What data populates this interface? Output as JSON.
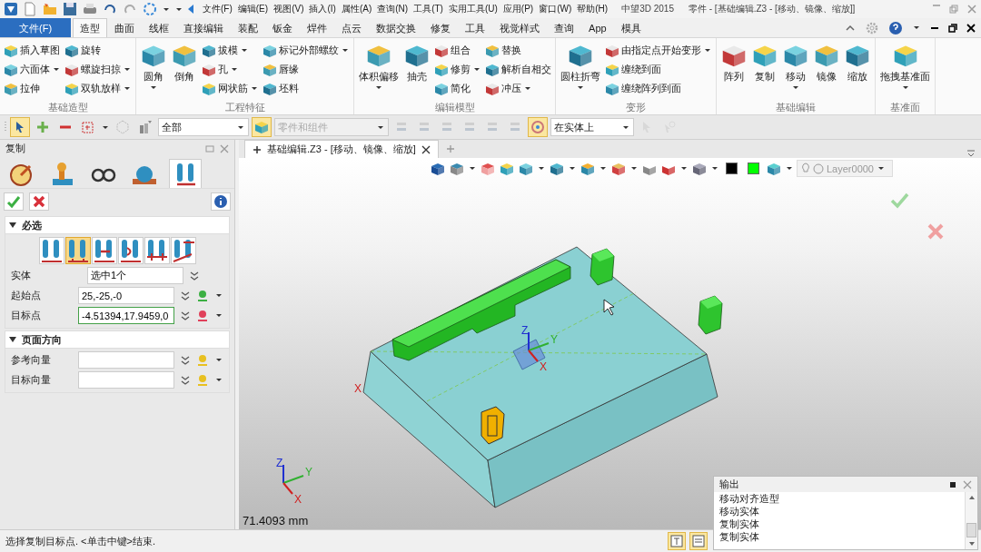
{
  "title_bar": {
    "menus": [
      "文件(F)",
      "编辑(E)",
      "视图(V)",
      "插入(I)",
      "属性(A)",
      "查询(N)",
      "工具(T)",
      "实用工具(U)",
      "应用(P)",
      "窗口(W)",
      "帮助(H)"
    ],
    "app_name": "中望3D 2015",
    "document_title": "零件 - [基础编辑.Z3 - [移动、镜像、缩放]]"
  },
  "ribbon_tabs": [
    {
      "label": "文件(F)",
      "kind": "file",
      "selected": false
    },
    {
      "label": "造型",
      "kind": "tab",
      "selected": true
    },
    {
      "label": "曲面",
      "kind": "tab",
      "selected": false
    },
    {
      "label": "线框",
      "kind": "tab",
      "selected": false
    },
    {
      "label": "直接编辑",
      "kind": "tab",
      "selected": false
    },
    {
      "label": "装配",
      "kind": "tab",
      "selected": false
    },
    {
      "label": "钣金",
      "kind": "tab",
      "selected": false
    },
    {
      "label": "焊件",
      "kind": "tab",
      "selected": false
    },
    {
      "label": "点云",
      "kind": "tab",
      "selected": false
    },
    {
      "label": "数据交换",
      "kind": "tab",
      "selected": false
    },
    {
      "label": "修复",
      "kind": "tab",
      "selected": false
    },
    {
      "label": "工具",
      "kind": "tab",
      "selected": false
    },
    {
      "label": "视觉样式",
      "kind": "tab",
      "selected": false
    },
    {
      "label": "查询",
      "kind": "tab",
      "selected": false
    },
    {
      "label": "App",
      "kind": "tab",
      "selected": false
    },
    {
      "label": "模具",
      "kind": "tab",
      "selected": false
    }
  ],
  "ribbon": {
    "groups": [
      {
        "label": "基础造型",
        "items": [
          {
            "kind": "small",
            "label": "插入草图",
            "dropdown": false
          },
          {
            "kind": "small",
            "label": "六面体",
            "dropdown": true
          },
          {
            "kind": "small",
            "label": "拉伸",
            "dropdown": false
          },
          {
            "kind": "small",
            "label": "旋转",
            "dropdown": false
          },
          {
            "kind": "small",
            "label": "螺旋扫掠",
            "dropdown": true
          },
          {
            "kind": "small",
            "label": "双轨放样",
            "dropdown": true
          }
        ]
      },
      {
        "label": "工程特征",
        "items": [
          {
            "kind": "large",
            "label": "圆角",
            "dropdown": true
          },
          {
            "kind": "large",
            "label": "倒角",
            "dropdown": false
          },
          {
            "kind": "small",
            "label": "拔模",
            "dropdown": true
          },
          {
            "kind": "small",
            "label": "孔",
            "dropdown": true
          },
          {
            "kind": "small",
            "label": "网状筋",
            "dropdown": true
          },
          {
            "kind": "small",
            "label": "标记外部螺纹",
            "dropdown": true
          },
          {
            "kind": "small",
            "label": "唇缘",
            "dropdown": false
          },
          {
            "kind": "small",
            "label": "坯料",
            "dropdown": false
          }
        ]
      },
      {
        "label": "编辑模型",
        "items": [
          {
            "kind": "large",
            "label": "体积偏移",
            "dropdown": true
          },
          {
            "kind": "large",
            "label": "抽壳",
            "dropdown": false
          },
          {
            "kind": "small",
            "label": "组合",
            "dropdown": false
          },
          {
            "kind": "small",
            "label": "修剪",
            "dropdown": true
          },
          {
            "kind": "small",
            "label": "简化",
            "dropdown": false
          },
          {
            "kind": "small",
            "label": "替换",
            "dropdown": false
          },
          {
            "kind": "small",
            "label": "解析自相交",
            "dropdown": false
          },
          {
            "kind": "small",
            "label": "冲压",
            "dropdown": true
          }
        ]
      },
      {
        "label": "变形",
        "items": [
          {
            "kind": "large",
            "label": "圆柱折弯",
            "dropdown": true
          },
          {
            "kind": "small",
            "label": "由指定点开始变形",
            "dropdown": true
          },
          {
            "kind": "small",
            "label": "缠绕到面",
            "dropdown": false
          },
          {
            "kind": "small",
            "label": "缠绕阵列到面",
            "dropdown": false
          }
        ]
      },
      {
        "label": "基础编辑",
        "items": [
          {
            "kind": "large",
            "label": "阵列",
            "dropdown": false
          },
          {
            "kind": "large",
            "label": "复制",
            "dropdown": false
          },
          {
            "kind": "large",
            "label": "移动",
            "dropdown": true
          },
          {
            "kind": "large",
            "label": "镜像",
            "dropdown": false
          },
          {
            "kind": "large",
            "label": "缩放",
            "dropdown": false
          }
        ]
      },
      {
        "label": "基准面",
        "items": [
          {
            "kind": "large",
            "label": "拖拽基准面",
            "dropdown": true
          }
        ]
      }
    ]
  },
  "toolbar": {
    "filter": "全部",
    "scope": "零件和组件",
    "scope_disabled": true,
    "snap": "在实体上"
  },
  "panel": {
    "title": "复制",
    "tabs": [
      {
        "selected": false
      },
      {
        "selected": false
      },
      {
        "selected": false
      },
      {
        "selected": false
      },
      {
        "selected": true
      }
    ],
    "sections": [
      {
        "title": "必选",
        "expanded": true,
        "modes": [
          {
            "selected": false
          },
          {
            "selected": true
          },
          {
            "selected": false
          },
          {
            "selected": false
          },
          {
            "selected": false
          },
          {
            "selected": false
          }
        ],
        "fields": [
          {
            "label": "实体",
            "value": "选中1个",
            "kind": "select",
            "focused": false
          },
          {
            "label": "起始点",
            "value": "25,-25,-0",
            "kind": "point",
            "focused": false,
            "color": "#3cb043"
          },
          {
            "label": "目标点",
            "value": "-4.51394,17.9459,0",
            "kind": "point",
            "focused": true,
            "color": "#e0405a"
          }
        ]
      },
      {
        "title": "页面方向",
        "expanded": true,
        "fields": [
          {
            "label": "参考向量",
            "kind": "point",
            "focused": false,
            "color": "#e8c020"
          },
          {
            "label": "目标向量",
            "kind": "point",
            "focused": false,
            "color": "#e8c020"
          }
        ]
      }
    ]
  },
  "document_tab": {
    "label": "基础编辑.Z3 - [移动、镜像、缩放]"
  },
  "view_toolbar": {
    "swatches": [
      {
        "color": "#000000"
      },
      {
        "color": "#00ff00"
      }
    ],
    "layer": "Layer0000"
  },
  "viewport": {
    "edge_label": "X",
    "triads": [
      {
        "x": "X",
        "y": "Y",
        "z": "Z"
      },
      {
        "x": "X",
        "y": "Y",
        "z": "Z"
      }
    ],
    "measurement": "71.4093 mm"
  },
  "output": {
    "title": "输出",
    "lines": [
      "移动对齐造型",
      "移动实体",
      "复制实体",
      "复制实体"
    ]
  },
  "status_bar": {
    "message": "选择复制目标点. <单击中键>结束."
  }
}
